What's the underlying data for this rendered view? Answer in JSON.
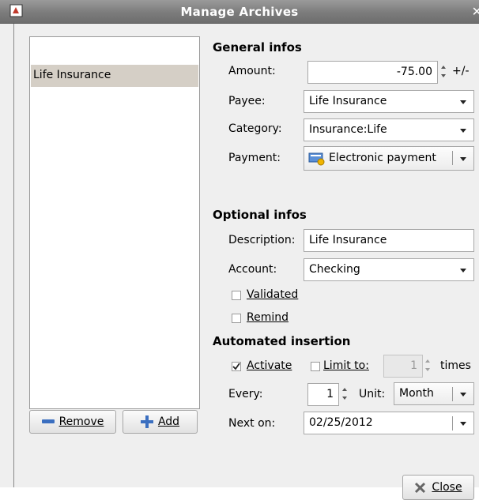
{
  "window": {
    "title": "Manage Archives"
  },
  "archive_list": {
    "items": [
      {
        "label": "Life Insurance",
        "selected": true
      }
    ]
  },
  "list_buttons": {
    "remove_label": "Remove",
    "add_label": "Add"
  },
  "general": {
    "heading": "General infos",
    "amount_label": "Amount:",
    "amount_value": "-75.00",
    "sign_label": "+/-",
    "payee_label": "Payee:",
    "payee_value": "Life Insurance",
    "category_label": "Category:",
    "category_value": "Insurance:Life",
    "payment_label": "Payment:",
    "payment_value": "Electronic payment"
  },
  "optional": {
    "heading": "Optional infos",
    "description_label": "Description:",
    "description_value": "Life Insurance",
    "account_label": "Account:",
    "account_value": "Checking",
    "validated_label": "Validated",
    "validated_checked": false,
    "remind_label": "Remind",
    "remind_checked": false
  },
  "automated": {
    "heading": "Automated insertion",
    "activate_label": "Activate",
    "activate_checked": true,
    "limit_label": "Limit to:",
    "limit_checked": false,
    "limit_value": "1",
    "times_label": "times",
    "every_label": "Every:",
    "every_value": "1",
    "unit_label": "Unit:",
    "unit_value": "Month",
    "next_label": "Next on:",
    "next_value": "02/25/2012"
  },
  "footer": {
    "close_label": "Close"
  }
}
